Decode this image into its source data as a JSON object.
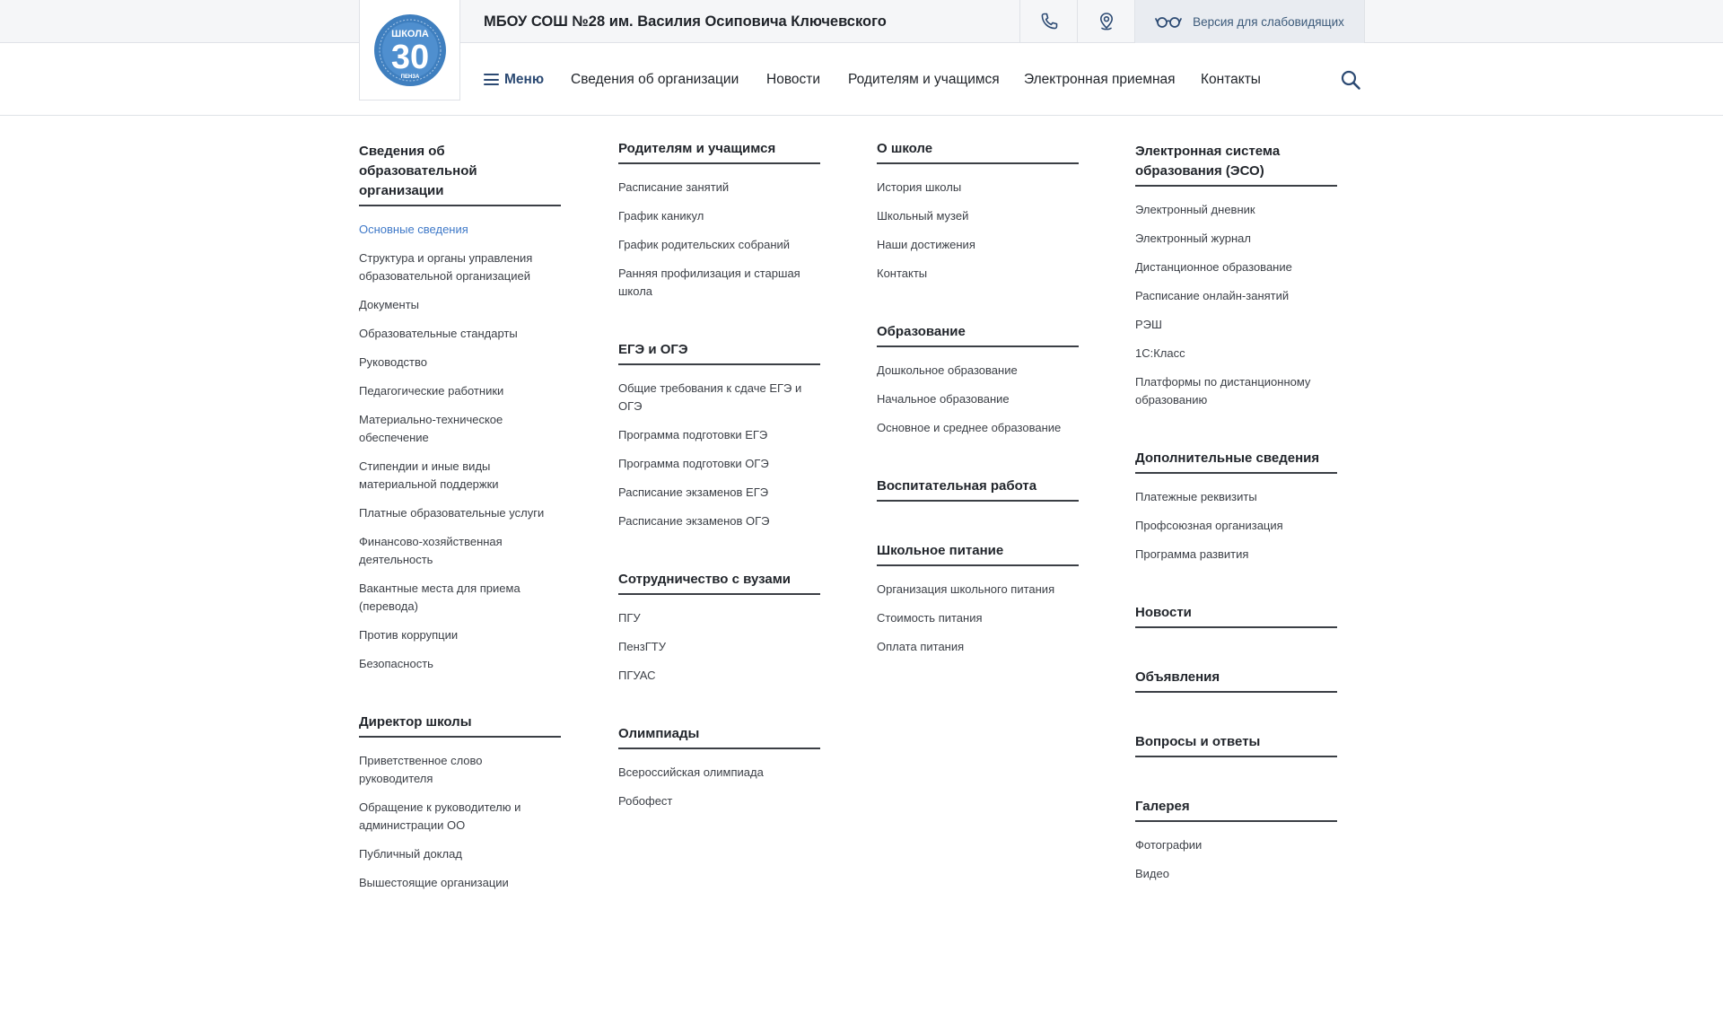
{
  "header": {
    "logo": {
      "word": "ШКОЛА",
      "number": "30",
      "city": "ПЕНЗА",
      "ring_color": "#3f7fbf",
      "fill_color": "#4f8fcf"
    },
    "school_title": "МБОУ СОШ №28 им. Василия Осиповича Ключевского",
    "phone_icon": "phone-icon",
    "map_icon": "map-pin-icon",
    "vision_icon": "glasses-icon",
    "vision_label": "Версия для слабовидящих"
  },
  "nav": {
    "menu_label": "Меню",
    "links": [
      "Сведения об организации",
      "Новости",
      "Родителям и учащимся",
      "Электронная приемная",
      "Контакты"
    ],
    "search_icon": "search-icon",
    "accent": "#2c4a73"
  },
  "menu": {
    "active_color": "#3f79c8",
    "col1": [
      {
        "title": "Сведения об образовательной организации",
        "items": [
          "Основные сведения",
          "Структура и органы управления образовательной организацией",
          "Документы",
          "Образовательные стандарты",
          "Руководство",
          "Педагогические работники",
          "Материально-техническое обеспечение",
          "Стипендии и иные виды материальной поддержки",
          "Платные образовательные услуги",
          "Финансово-хозяйственная деятельность",
          "Вакантные места для приема (перевода)",
          "Против коррупции",
          "Безопасность"
        ]
      },
      {
        "title": "Директор школы",
        "items": [
          "Приветственное слово руководителя",
          "Обращение к руководителю и администрации ОО",
          "Публичный доклад",
          "Вышестоящие организации"
        ]
      }
    ],
    "col2": [
      {
        "title": "Родителям и учащимся",
        "items": [
          "Расписание занятий",
          "График каникул",
          "График родительских собраний",
          "Ранняя профилизация и старшая школа"
        ]
      },
      {
        "title": "ЕГЭ и ОГЭ",
        "items": [
          "Общие требования к сдаче ЕГЭ и ОГЭ",
          "Программа подготовки ЕГЭ",
          "Программа подготовки ОГЭ",
          "Расписание экзаменов ЕГЭ",
          "Расписание экзаменов ОГЭ"
        ]
      },
      {
        "title": "Сотрудничество с вузами",
        "items": [
          "ПГУ",
          "ПензГТУ",
          "ПГУАС"
        ]
      },
      {
        "title": "Олимпиады",
        "items": [
          "Всероссийская олимпиада",
          "Робофест"
        ]
      }
    ],
    "col3": [
      {
        "title": "О школе",
        "items": [
          "История школы",
          "Школьный музей",
          "Наши достижения",
          "Контакты"
        ]
      },
      {
        "title": "Образование",
        "items": [
          "Дошкольное образование",
          "Начальное образование",
          "Основное и среднее образование"
        ]
      },
      {
        "title": "Воспитательная работа",
        "items": []
      },
      {
        "title": "Школьное питание",
        "items": [
          "Организация школьного питания",
          "Стоимость питания",
          "Оплата питания"
        ]
      }
    ],
    "col4": [
      {
        "title": "Электронная система образования (ЭСО)",
        "items": [
          "Электронный дневник",
          "Электронный журнал",
          "Дистанционное образование",
          "Расписание онлайн-занятий",
          "РЭШ",
          "1С:Класс",
          "Платформы по дистанционному образованию"
        ]
      },
      {
        "title": "Дополнительные сведения",
        "items": [
          "Платежные реквизиты",
          "Профсоюзная организация",
          "Программа развития"
        ]
      },
      {
        "title": "Новости",
        "items": []
      },
      {
        "title": "Объявления",
        "items": []
      },
      {
        "title": "Вопросы и ответы",
        "items": []
      },
      {
        "title": "Галерея",
        "items": [
          "Фотографии",
          "Видео"
        ]
      }
    ]
  }
}
